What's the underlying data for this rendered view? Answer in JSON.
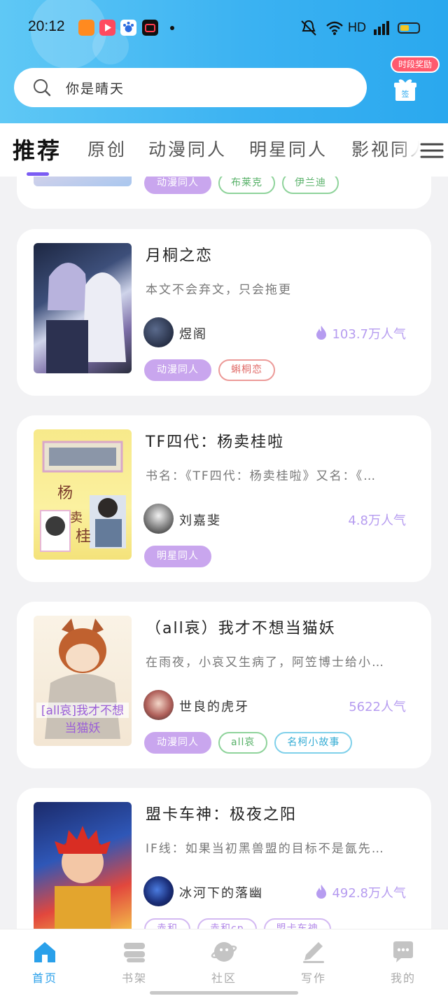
{
  "status_bar": {
    "time": "20:12",
    "network": "HD"
  },
  "search": {
    "placeholder": "你是晴天"
  },
  "reward": {
    "badge": "时段奖励",
    "gift_label": "签"
  },
  "tabs": [
    {
      "label": "推荐",
      "active": true
    },
    {
      "label": "原创"
    },
    {
      "label": "动漫同人"
    },
    {
      "label": "明星同人"
    },
    {
      "label": "影视同人"
    }
  ],
  "books": [
    {
      "title": "",
      "desc": "",
      "author": "",
      "popularity": "",
      "tags": [
        {
          "label": "动漫同人",
          "style": "fill"
        },
        {
          "label": "布莱克",
          "style": "green"
        },
        {
          "label": "伊兰迪",
          "style": "green"
        }
      ]
    },
    {
      "title": "月桐之恋",
      "desc": "本文不会弃文，只会拖更",
      "author": "煜阁",
      "popularity": "103.7万人气",
      "flame": true,
      "tags": [
        {
          "label": "动漫同人",
          "style": "fill"
        },
        {
          "label": "蝌桐恋",
          "style": "red"
        }
      ]
    },
    {
      "title": "TF四代：杨卖桂啦",
      "desc": "书名：《TF四代：杨卖桂啦》又名：《…",
      "author": "刘嘉斐",
      "popularity": "4.8万人气",
      "flame": false,
      "tags": [
        {
          "label": "明星同人",
          "style": "fill"
        }
      ]
    },
    {
      "title": "（all哀）我才不想当猫妖",
      "desc": "在雨夜，小哀又生病了，阿笠博士给小…",
      "author": "世良的虎牙",
      "popularity": "5622人气",
      "flame": false,
      "tags": [
        {
          "label": "动漫同人",
          "style": "fill"
        },
        {
          "label": "all哀",
          "style": "green"
        },
        {
          "label": "名柯小故事",
          "style": "blue"
        }
      ]
    },
    {
      "title": "盟卡车神：极夜之阳",
      "desc": "IF线：如果当初黑兽盟的目标不是氤先…",
      "author": "冰河下的落幽",
      "popularity": "492.8万人气",
      "flame": true,
      "tags": [
        {
          "label": "赤和",
          "style": "purple"
        },
        {
          "label": "赤和cp",
          "style": "purple"
        },
        {
          "label": "盟卡车神",
          "style": "purple"
        }
      ]
    }
  ],
  "bottom_nav": [
    {
      "label": "首页",
      "active": true,
      "icon": "home-icon"
    },
    {
      "label": "书架",
      "icon": "bookshelf-icon"
    },
    {
      "label": "社区",
      "icon": "community-icon"
    },
    {
      "label": "写作",
      "icon": "write-icon"
    },
    {
      "label": "我的",
      "icon": "profile-icon"
    }
  ],
  "colors": {
    "accent": "#2aa0ea",
    "tab_underline": "#7b5cf3",
    "popularity": "#b69cf0"
  }
}
